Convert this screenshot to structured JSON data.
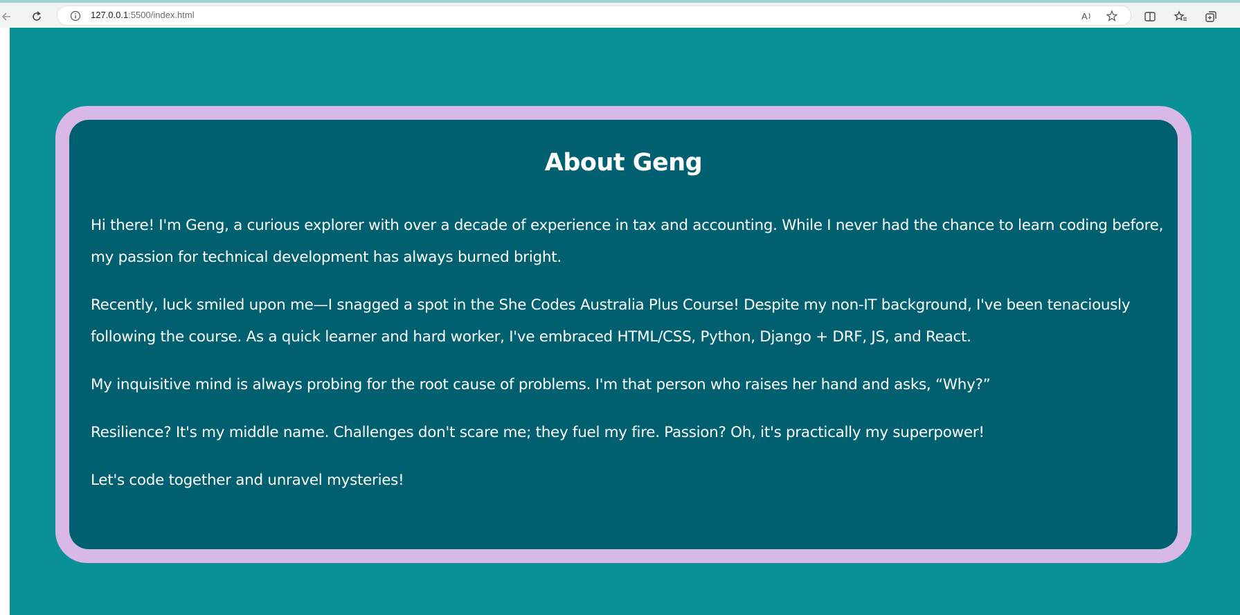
{
  "browser": {
    "url_host": "127.0.0.1",
    "url_rest": ":5500/index.html",
    "icons": [
      "back-icon",
      "refresh-icon",
      "info-icon",
      "read-aloud-icon",
      "favorite-star-icon",
      "split-screen-icon",
      "favorites-icon",
      "collections-icon"
    ]
  },
  "about": {
    "title": "About Geng",
    "paragraphs": [
      "Hi there! I'm Geng, a curious explorer with over a decade of experience in tax and accounting. While I never had the chance to learn coding before, my passion for technical development has always burned bright.",
      "Recently, luck smiled upon me—I snagged a spot in the She Codes Australia Plus Course! Despite my non-IT background, I've been tenaciously following the course. As a quick learner and hard worker, I've embraced HTML/CSS, Python, Django + DRF, JS, and React.",
      "My inquisitive mind is always probing for the root cause of problems. I'm that person who raises her hand and asks, “Why?”",
      "Resilience? It's my middle name. Challenges don't scare me; they fuel my fire. Passion? Oh, it's practically my superpower!",
      "Let's code together and unravel mysteries!"
    ]
  },
  "colors": {
    "page_bg": "#0a9196",
    "card_border": "#d7b8e6",
    "card_bg": "#00606f",
    "text": "#ffffff"
  }
}
